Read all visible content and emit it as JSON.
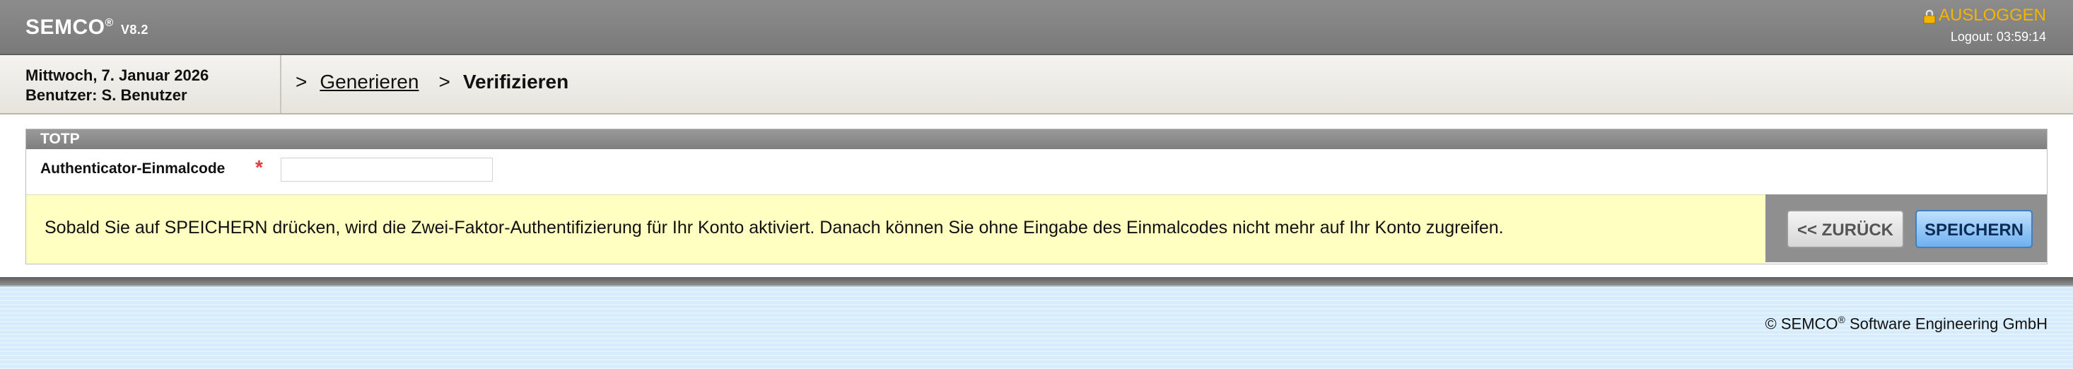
{
  "header": {
    "brand": "SEMCO",
    "brand_mark": "®",
    "version": "V8.2",
    "logout_label": "AUSLOGGEN",
    "logout_timer": "Logout: 03:59:14",
    "logout_icon": "lock-icon",
    "logout_color": "#f4b400"
  },
  "session": {
    "date": "Mittwoch, 7. Januar 2026",
    "user": "Benutzer: S. Benutzer"
  },
  "breadcrumb": {
    "sep1": ">",
    "item1": "Generieren",
    "sep2": ">",
    "item2": "Verifizieren"
  },
  "panel": {
    "title": "TOTP",
    "field_label": "Authenticator-Einmalcode",
    "required_mark": "*",
    "field_value": "",
    "notice": "Sobald Sie auf SPEICHERN drücken, wird die Zwei-Faktor-Authentifizierung für Ihr Konto aktiviert. Danach können Sie ohne Eingabe des Einmalcodes nicht mehr auf Ihr Konto zugreifen.",
    "back_label": "<< ZURÜCK",
    "save_label": "SPEICHERN"
  },
  "footer": {
    "copyright_prefix": "© SEMCO",
    "copyright_mark": "®",
    "copyright_suffix": " Software Engineering GmbH"
  }
}
